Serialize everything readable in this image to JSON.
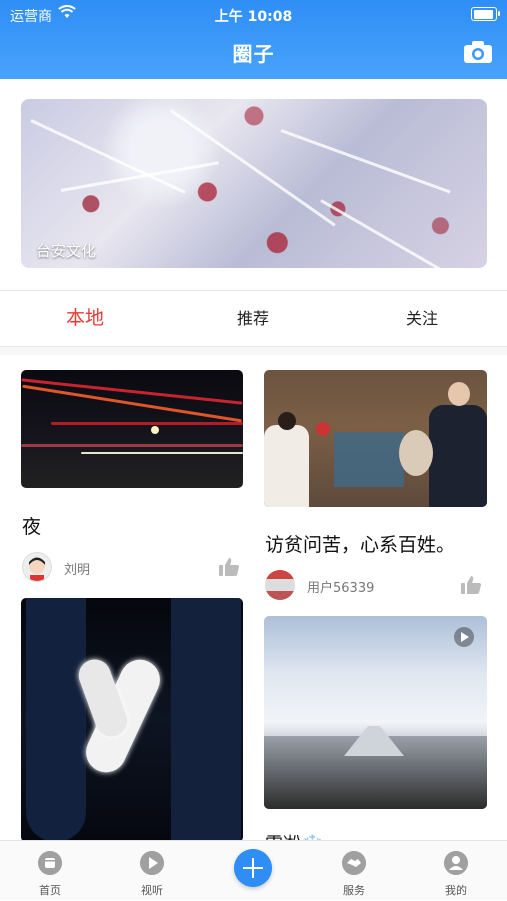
{
  "status_bar": {
    "carrier": "运营商",
    "time": "上午 10:08"
  },
  "header": {
    "title": "圈子",
    "camera_icon": "camera-icon"
  },
  "banner": {
    "caption": "台安文化"
  },
  "tabs": [
    {
      "label": "本地",
      "active": true
    },
    {
      "label": "推荐",
      "active": false
    },
    {
      "label": "关注",
      "active": false
    }
  ],
  "feed": [
    {
      "title": "夜",
      "author": "刘明"
    },
    {
      "title": "访贫问苦，心系百姓。",
      "author": "用户56339"
    },
    {
      "title": "",
      "author": ""
    },
    {
      "title": "雪凇❄️",
      "author": ""
    }
  ],
  "bottom_nav": [
    {
      "label": "首页",
      "icon": "home-icon"
    },
    {
      "label": "视听",
      "icon": "play-icon"
    },
    {
      "label": "",
      "icon": "plus-icon"
    },
    {
      "label": "服务",
      "icon": "handshake-icon"
    },
    {
      "label": "我的",
      "icon": "user-icon"
    }
  ],
  "colors": {
    "header": "#2f8ef6",
    "active_tab": "#e83b32"
  }
}
